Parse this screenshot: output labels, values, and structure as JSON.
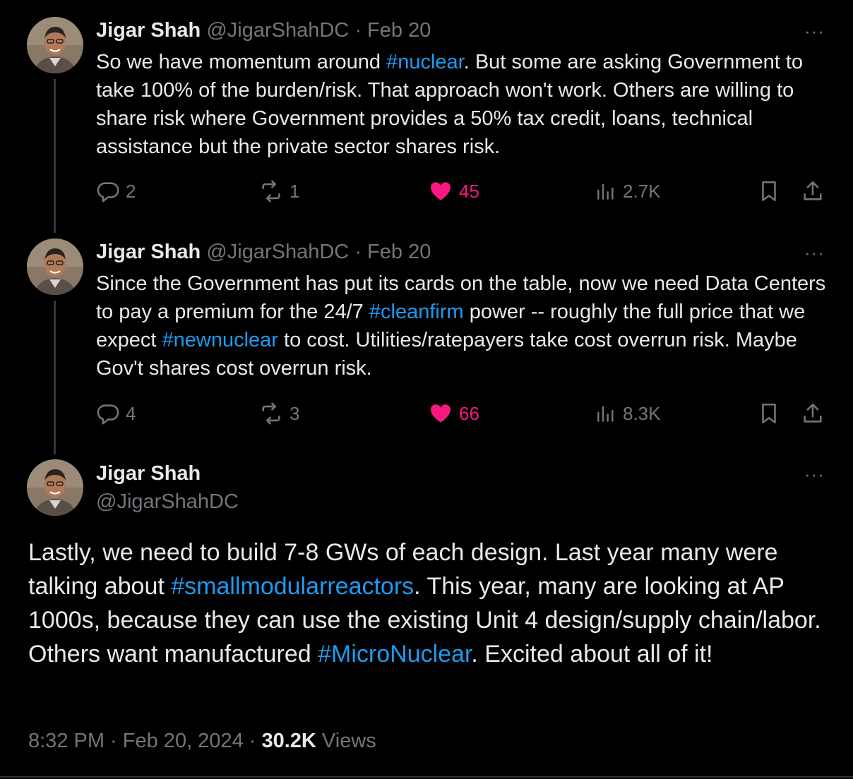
{
  "tweets": [
    {
      "name": "Jigar Shah",
      "handle": "@JigarShahDC",
      "date_sep": " · ",
      "date": "Feb 20",
      "more": "···",
      "text": [
        {
          "t": "So we have momentum around "
        },
        {
          "t": "#nuclear",
          "tag": true
        },
        {
          "t": ". But some are asking Government to take 100% of the burden/risk. That approach won't work. Others are willing to share risk where Government provides a 50% tax credit, loans, technical assistance but the private sector shares risk."
        }
      ],
      "replies": "2",
      "reposts": "1",
      "likes": "45",
      "views": "2.7K"
    },
    {
      "name": "Jigar Shah",
      "handle": "@JigarShahDC",
      "date_sep": " · ",
      "date": "Feb 20",
      "more": "···",
      "text": [
        {
          "t": "Since the Government has put its cards on the table, now we need Data Centers to pay a premium for the 24/7 "
        },
        {
          "t": "#cleanfirm",
          "tag": true
        },
        {
          "t": " power -- roughly the full price that we expect "
        },
        {
          "t": "#newnuclear",
          "tag": true
        },
        {
          "t": " to cost. Utilities/ratepayers take cost overrun risk. Maybe Gov't shares cost overrun risk."
        }
      ],
      "replies": "4",
      "reposts": "3",
      "likes": "66",
      "views": "8.3K"
    }
  ],
  "main_tweet": {
    "name": "Jigar Shah",
    "handle": "@JigarShahDC",
    "more": "···",
    "text": [
      {
        "t": "Lastly, we need to build 7-8 GWs of each design. Last year many were talking about "
      },
      {
        "t": "#smallmodularreactors",
        "tag": true
      },
      {
        "t": ". This year, many are looking at AP 1000s, because they can use the existing Unit 4 design/supply chain/labor. Others want manufactured "
      },
      {
        "t": "#MicroNuclear",
        "tag": true
      },
      {
        "t": ". Excited about all of it!"
      }
    ],
    "time": "8:32 PM",
    "sep1": " · ",
    "date": "Feb 20, 2024",
    "sep2": " · ",
    "views_count": "30.2K",
    "views_label": " Views"
  },
  "colors": {
    "background": "#000000",
    "text": "#e7e9ea",
    "muted": "#71767b",
    "link": "#1d9bf0",
    "like": "#f91880"
  },
  "icons": [
    "reply-icon",
    "repost-icon",
    "heart-icon",
    "views-icon",
    "bookmark-icon",
    "share-icon",
    "more-icon"
  ]
}
